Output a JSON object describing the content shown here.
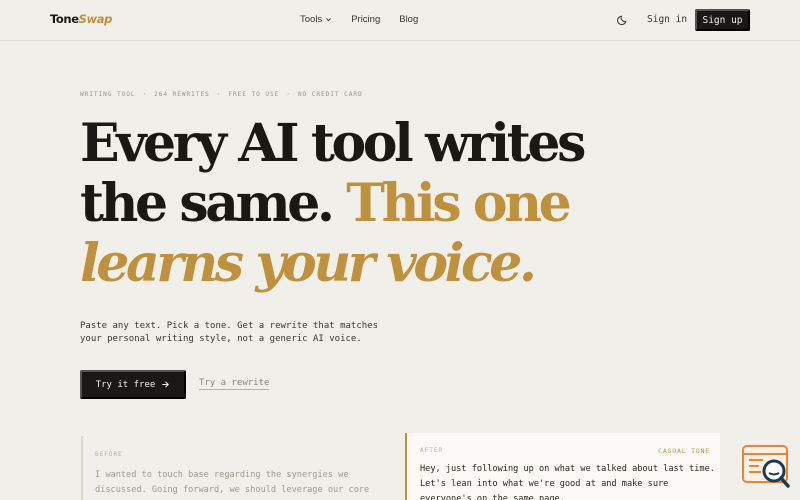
{
  "nav": {
    "logo_main": "Tone",
    "logo_accent": "Swap",
    "links": [
      {
        "label": "Tools",
        "icon": "chevron-down-icon"
      },
      {
        "label": "Pricing"
      },
      {
        "label": "Blog"
      }
    ],
    "theme_icon": "moon-icon",
    "signin_label": "Sign in",
    "signup_label": "Sign up"
  },
  "hero": {
    "meta": [
      "WRITING TOOL",
      "·",
      "264 REWRITES",
      "·",
      "FREE TO USE",
      "·",
      "NO CREDIT CARD"
    ],
    "headline_line1": "Every AI tool writes",
    "headline_line2_plain": "the same. ",
    "headline_line2_accent": "This one",
    "headline_line3": "learns your voice.",
    "subcopy": "Paste any text. Pick a tone. Get a rewrite that matches your personal writing style, not a generic AI voice.",
    "cta_label": "Try it free",
    "cta_icon": "arrow-right-icon",
    "secondary_label": "Try a rewrite"
  },
  "demo": {
    "before_label": "BEFORE",
    "before_text": "I wanted to touch base regarding the synergies we discussed. Going forward, we should leverage our core",
    "after_label": "AFTER",
    "after_tone": "CASUAL TONE",
    "after_text": "Hey, just following up on what we talked about last time. Let's lean into what we're good at and make sure everyone's on the same page."
  },
  "widget": {
    "icon": "chat-search-icon"
  },
  "colors": {
    "background": "#f1efea",
    "ink": "#1b1714",
    "accent_gold": "#c0913c",
    "widget_orange": "#e8833a"
  }
}
